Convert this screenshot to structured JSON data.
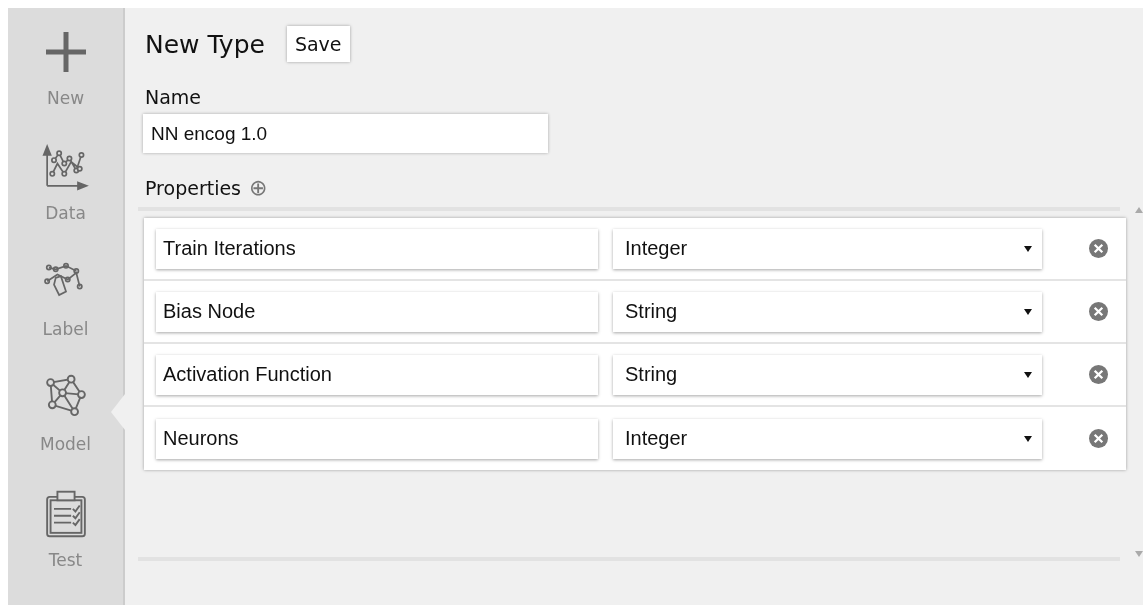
{
  "sidebar": {
    "items": [
      {
        "kind": "new",
        "label": "New",
        "selected": false
      },
      {
        "kind": "data",
        "label": "Data",
        "selected": false
      },
      {
        "kind": "label",
        "label": "Label",
        "selected": false
      },
      {
        "kind": "model",
        "label": "Model",
        "selected": true
      },
      {
        "kind": "test",
        "label": "Test",
        "selected": false
      }
    ]
  },
  "header": {
    "title": "New Type",
    "save_button": "Save"
  },
  "name_field": {
    "label": "Name",
    "value": "NN encog 1.0"
  },
  "properties": {
    "label": "Properties",
    "add_icon": "⊕",
    "rows": [
      {
        "name": "Train Iterations",
        "type": "Integer"
      },
      {
        "name": "Bias Node",
        "type": "String"
      },
      {
        "name": "Activation Function",
        "type": "String"
      },
      {
        "name": "Neurons",
        "type": "Integer"
      }
    ]
  }
}
